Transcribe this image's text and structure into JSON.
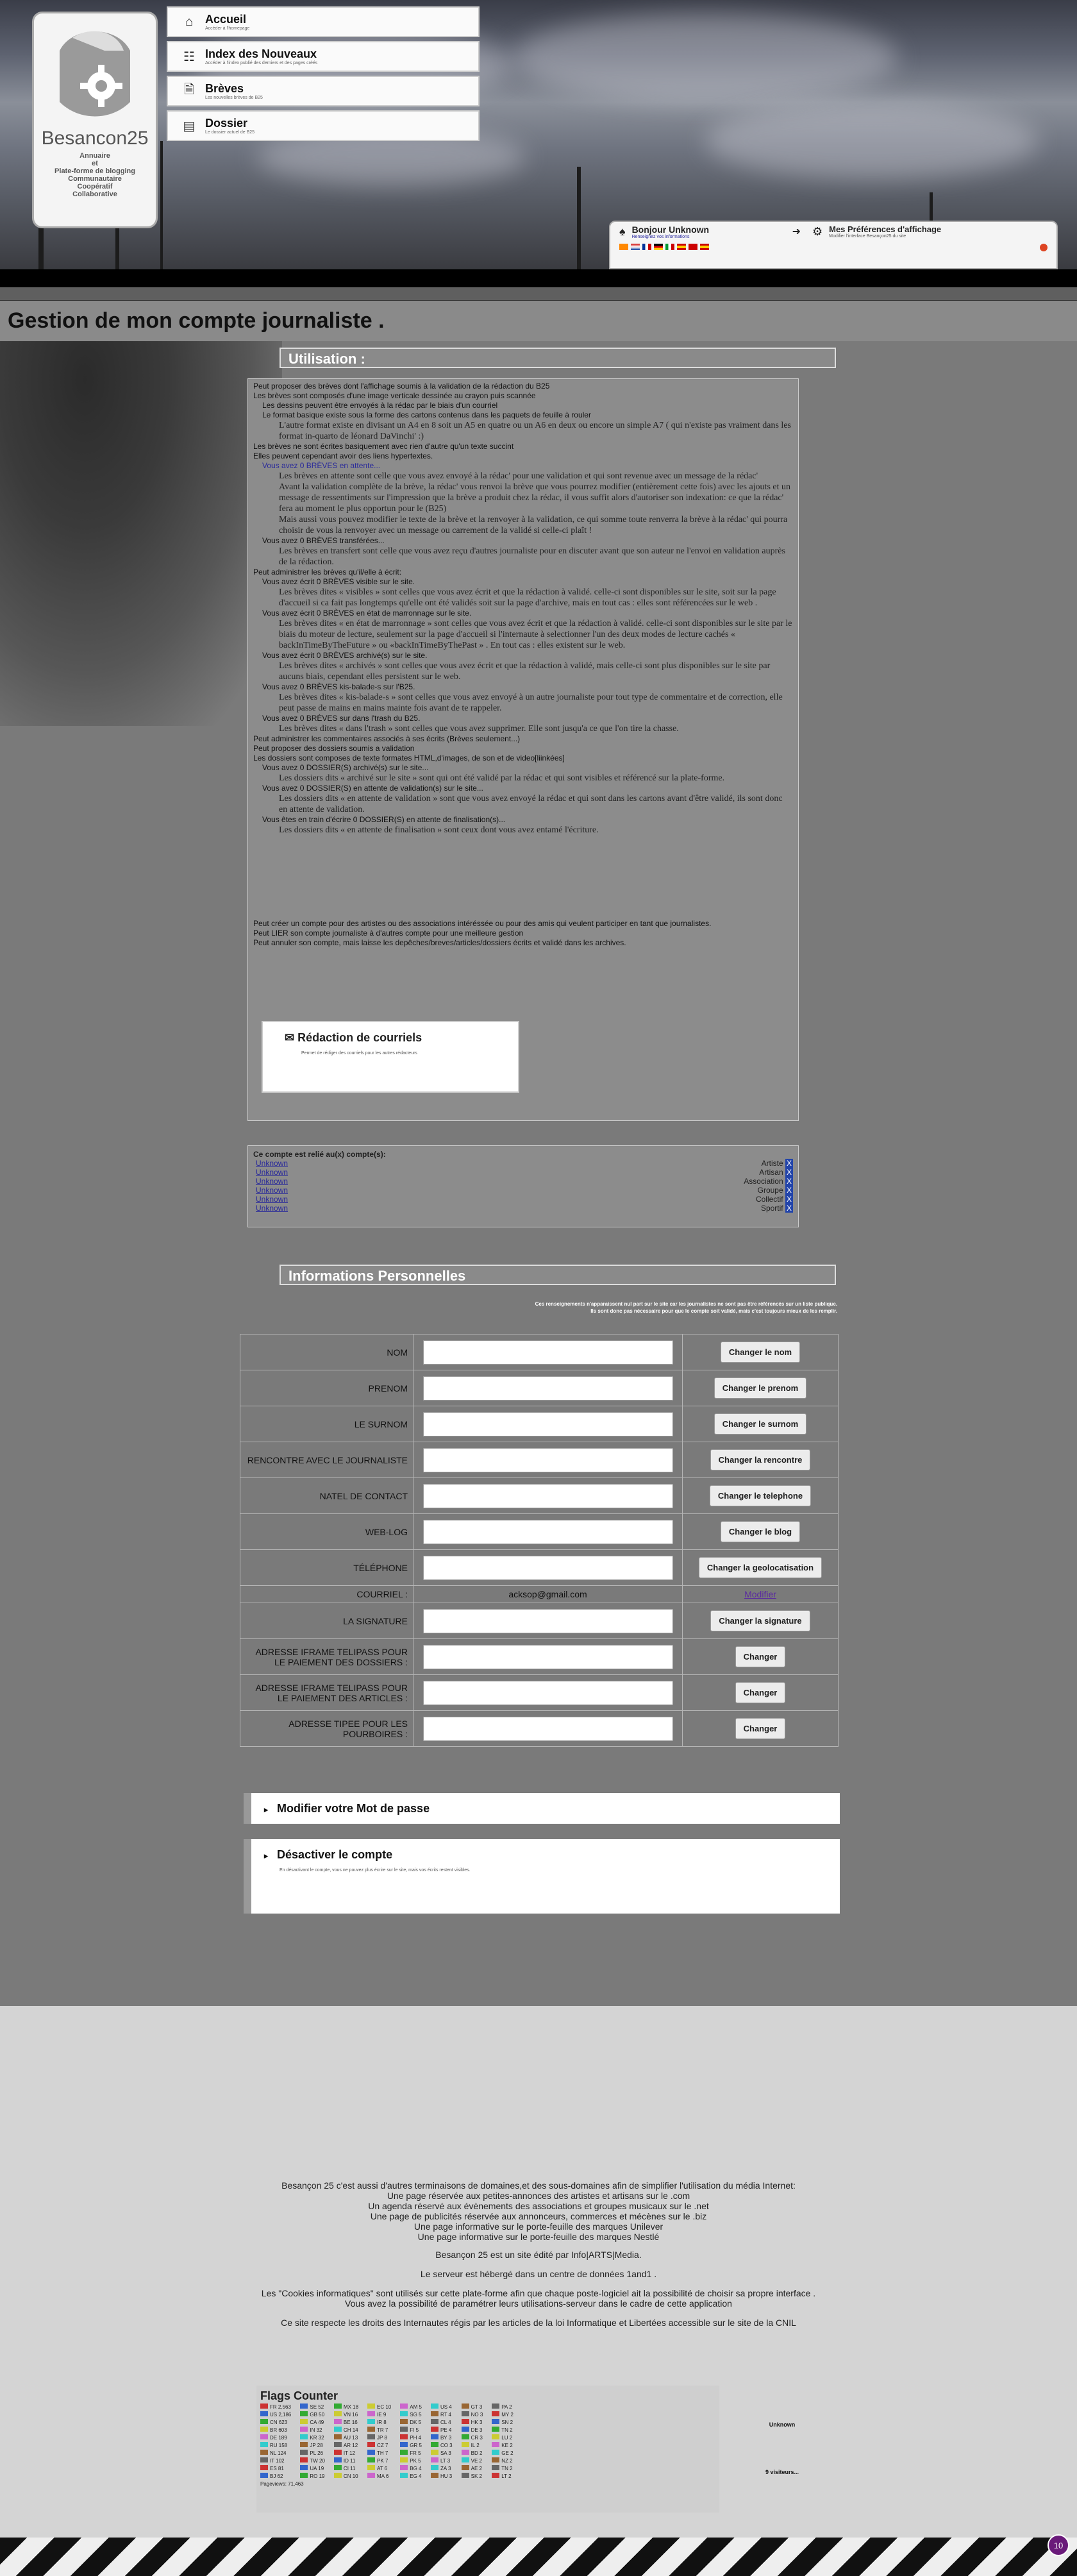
{
  "logo": {
    "brand": "Besancon25",
    "tagline": [
      "Annuaire",
      "et",
      "Plate-forme de blogging",
      "Communautaire",
      "Coopératif",
      "Collaborative"
    ]
  },
  "nav": [
    {
      "title": "Accueil",
      "subtitle": "Accéder à l'homepage",
      "icon": "home-icon"
    },
    {
      "title": "Index des Nouveaux",
      "subtitle": "Accéder à l'index publié des derniers et des pages créés",
      "icon": "sitemap-icon"
    },
    {
      "title": "Brèves",
      "subtitle": "Les nouvelles brèves de B25",
      "icon": "file-icon"
    },
    {
      "title": "Dossier",
      "subtitle": "Le dossier actuel de B25",
      "icon": "newspaper-icon"
    }
  ],
  "user": {
    "hello": "Bonjour Unknown",
    "hello_sub": "Renseignez vos informations",
    "prefs": "Mes Préférences d'affichage",
    "prefs_sub": "Modifier l'interface Besançon25 du site"
  },
  "page_title": "Gestion de mon compte journaliste .",
  "usage": {
    "heading": "Utilisation :",
    "lines": [
      "Peut proposer des brèves dont l'affichage soumis à la validation de la rédaction du B25",
      "Les brèves sont composés d'une image verticale dessinée au crayon puis scannée",
      "Les dessins peuvent être envoyés à la rédac par le biais d'un courriel",
      "Le format basique existe sous la forme des cartons contenus dans les paquets de feuille à rouler",
      "Les brèves ne sont écrites basiquement avec rien d'autre qu'un texte succint",
      "Elles peuvent cependant avoir des liens hypertextes.",
      "Vous avez 0 BRÈVES en attente..."
    ],
    "para_format": "L'autre format existe en divisant un A4 en 8 soit un A5 en quatre ou un A6 en deux ou encore un simple A7 ( qui n'existe pas vraiment dans les format in-quarto de léonard DaVinchi' :)",
    "para_attente": "Les brèves en attente sont celle que vous avez envoyé à la rédac' pour une validation et qui sont revenue avec un message de la rédac'",
    "para_validation": "Avant la validation complète de la brève, la rédac' vous renvoi la brève que vous pourrez modifier (entièrement cette fois) avec les ajouts et un message de ressentiments sur l'impression que la brève a produit chez la rédac, il vous suffit alors d'autoriser son indexation: ce que la rédac' fera au moment le plus opportun pour le (B25)",
    "para_renvoyer": "Mais aussi vous pouvez modifier le texte de la brève et la renvoyer à la validation, ce qui somme toute renverra la brève à la rédac' qui pourra choisir de vous la renvoyer avec un message ou carrement de la validé si celle-ci plaît !",
    "transferees": "Vous avez 0 BRÈVES transférées...",
    "para_transfert": "Les brèves en transfert sont celle que vous avez reçu d'autres journaliste pour en discuter avant que son auteur ne l'envoi en validation auprès de la rédaction.",
    "administrer": "Peut administrer les brèves qu'il/elle à écrit:",
    "visibles": "Vous avez écrit 0 BRÈVES visible sur le site.",
    "para_visibles": "Les brèves dites « visibles » sont celles que vous avez écrit et que la rédaction à validé. celle-ci sont disponibles sur le site, soit sur la page d'accueil si ca fait pas longtemps qu'elle ont été validés soit sur la page d'archive, mais en tout cas : elles sont référencées sur le web .",
    "marronnage": "Vous avez écrit 0 BRÈVES en état de marronnage sur le site.",
    "para_marronnage": "Les brèves dites « en état de marronnage » sont celles que vous avez écrit et que la rédaction à validé. celle-ci sont disponibles sur le site par le biais du moteur de lecture, seulement sur la page d'accueil si l'internaute à selectionner l'un des deux modes de lecture cachés « backInTimeByTheFuture » ou «backInTimeByThePast » . En tout cas : elles existent sur le web.",
    "archive": "Vous avez écrit 0 BRÈVES archivé(s) sur le site.",
    "para_archive": "Les brèves dites « archivés » sont celles que vous avez écrit et que la rédaction à validé, mais celle-ci sont plus disponibles sur le site par aucuns biais, cependant elles persistent sur le web.",
    "kis": "Vous avez 0 BRÈVES kis-balade-s sur l'B25.",
    "para_kis": "Les brèves dites « kis-balade-s » sont celles que vous avez envoyé à un autre journaliste pour tout type de commentaire et de correction, elle peut passe de mains en mains mainte fois avant de te rappeler.",
    "trash": "Vous avez 0 BRÈVES sur dans l'trash du B25.",
    "para_trash": "Les brèves dites « dans l'trash » sont celles que vous avez supprimer. Elle sont jusqu'a ce que l'on tire la chasse.",
    "commentaires": "Peut administrer les commentaires associés à ses écrits (Brèves seulement...)",
    "dossiers": "Peut proposer des dossiers soumis a validation",
    "dossiers_composes": "Les dossiers sont composes de texte formates HTML,d'images, de son et de video[liinkées]",
    "dossiers_archive": "Vous avez 0 DOSSIER(S) archivé(s) sur le site...",
    "para_dossiers_archive": "Les dossiers dits « archivé sur le site » sont qui ont été validé par la rédac et qui sont visibles et référencé sur la plate-forme.",
    "dossiers_attente": "Vous avez 0 DOSSIER(S) en attente de validation(s) sur le site...",
    "para_dossiers_attente": "Les dossiers dits « en attente de validation » sont que vous avez envoyé la rédac et qui sont dans les cartons avant d'être validé, ils sont donc en attente de validation.",
    "dossiers_finalisation": "Vous êtes en train d'écrire 0 DOSSIER(S) en attente de finalisation(s)...",
    "para_dossiers_finalisation": "Les dossiers dits « en attente de finalisation » sont ceux dont vous avez entamé l'écriture.",
    "courriels_title": "Rédaction de courriels",
    "courriels_sub": "Permet de rédiger des courriels pour les autres rédacteurs",
    "creer": "Peut créer un compte pour des artistes ou des associations intéréssée ou pour des amis qui veulent participer en tant que journalistes.",
    "lier": "Peut LIER son compte journaliste à d'autres compte pour une meilleure gestion",
    "annuler": "Peut annuler son compte, mais laisse les depêches/breves/articles/dossiers écrits et validé dans les archives."
  },
  "linked": {
    "heading": "Ce compte est relié au(x) compte(s):",
    "accounts": [
      {
        "name": "Unknown",
        "type": "Artiste"
      },
      {
        "name": "Unknown",
        "type": "Artisan"
      },
      {
        "name": "Unknown",
        "type": "Association"
      },
      {
        "name": "Unknown",
        "type": "Groupe"
      },
      {
        "name": "Unknown",
        "type": "Collectif"
      },
      {
        "name": "Unknown",
        "type": "Sportif"
      }
    ]
  },
  "info": {
    "heading": "Informations Personnelles",
    "note1": "Ces renseignements n'apparaissent nul part sur le site car les journalistes ne sont pas être référencés sur un liste publique.",
    "note2": "Ils sont donc pas nécessaire pour que le compte soit validé, mais c'est toujours mieux de les remplir.",
    "rows": [
      {
        "label": "NOM",
        "button": "Changer le nom"
      },
      {
        "label": "PRENOM",
        "button": "Changer le prenom"
      },
      {
        "label": "LE SURNOM",
        "button": "Changer le surnom"
      },
      {
        "label": "RENCONTRE AVEC LE JOURNALISTE",
        "button": "Changer la rencontre"
      },
      {
        "label": "NATEL DE CONTACT",
        "button": "Changer  le telephone"
      },
      {
        "label": "WEB-LOG",
        "button": "Changer le blog"
      },
      {
        "label": "TÉLÉPHONE",
        "button": "Changer la geolocatisation"
      }
    ],
    "courriel_label": "COURRIEL :",
    "courriel_value": "acksop@gmail.com",
    "courriel_action": "Modifier",
    "rows2": [
      {
        "label": "LA SIGNATURE",
        "button": "Changer la signature"
      },
      {
        "label": "ADRESSE IFRAME TELIPASS POUR LE PAIEMENT DES DOSSIERS :",
        "button": "Changer"
      },
      {
        "label": "ADRESSE IFRAME TELIPASS POUR LE PAIEMENT DES ARTICLES :",
        "button": "Changer"
      },
      {
        "label": "ADRESSE TIPEE POUR LES POURBOIRES :",
        "button": "Changer"
      }
    ]
  },
  "password": {
    "title": "Modifier votre Mot de passe"
  },
  "deactivate": {
    "title": "Désactiver le compte",
    "desc": "En désactivant le compte, vous ne pouvez plus écrire sur le site, mais vos écrits restent visibles."
  },
  "footer": {
    "lines": [
      "Besançon 25 c'est aussi d'autres terminaisons de domaines,et des sous-domaines afin de simplifier l'utilisation du média Internet:",
      "Une page réservée aux petites-annonces des artistes et artisans sur le .com",
      "Un agenda réservé aux évènements des associations et groupes musicaux sur le .net",
      "Une page de publicités réservée aux annonceurs, commerces et mécènes sur le .biz",
      "Une page informative sur le porte-feuille des marques Unilever",
      "Une page informative sur le porte-feuille des marques Nestlé"
    ],
    "edited": "Besançon 25 est un site édité par Info|ARTS|Media.",
    "hosted": "Le serveur est hébergé dans un centre de données 1and1 .",
    "cookies": "Les \"Cookies informatiques\" sont utilisés sur cette plate-forme afin que chaque poste-logiciel ait la possibilité de choisir sa propre interface .",
    "cookies2": "Vous avez la possibilité de paramétrer leurs utilisations-serveur dans le cadre de cette application",
    "cnil": "Ce site respecte les droits des Internautes régis par les articles de la loi Informatique et Libertées accessible sur le site de la CNIL",
    "flags_title": "Flags Counter",
    "flags": [
      [
        "FR 2,563",
        "US 2,186",
        "CN 623",
        "BR 603",
        "DE 189",
        "RU 158",
        "NL 124",
        "IT 102",
        "ES 81",
        "BJ 62"
      ],
      [
        "SE 52",
        "GB 50",
        "CA 49",
        "IN 32",
        "KR 32",
        "JP 28",
        "PL 26",
        "TW 20",
        "UA 19",
        "RO 19"
      ],
      [
        "MX 18",
        "VN 16",
        "BE 16",
        "CH 14",
        "AU 13",
        "AR 12",
        "IT 12",
        "ID 11",
        "CI 11",
        "CN 10"
      ],
      [
        "EC 10",
        "IE 9",
        "IR 8",
        "TR 7",
        "JP 8",
        "CZ 7",
        "TH 7",
        "PK 7",
        "AT 6",
        "MA 6"
      ],
      [
        "AM 5",
        "SG 5",
        "DK 5",
        "FI 5",
        "PH 4",
        "GR 5",
        "FR 5",
        "PK 5",
        "BG 4",
        "EG 4"
      ],
      [
        "US 4",
        "RT 4",
        "CL 4",
        "PE 4",
        "BY 3",
        "CO 3",
        "SA 3",
        "LT 3",
        "ZA 3",
        "HU 3"
      ],
      [
        "GT 3",
        "NO 3",
        "HK 3",
        "DE 3",
        "CR 3",
        "IL 2",
        "BD 2",
        "VE 2",
        "AE 2",
        "SK 2"
      ],
      [
        "PA 2",
        "MY 2",
        "SN 2",
        "TN 2",
        "LU 2",
        "KE 2",
        "GE 2",
        "NZ 2",
        "TN 2",
        "LT 2"
      ]
    ],
    "pageviews": "Pageviews: 71,463",
    "unknown": "Unknown",
    "visitors": "9 visiteurs..."
  },
  "badge": "10"
}
